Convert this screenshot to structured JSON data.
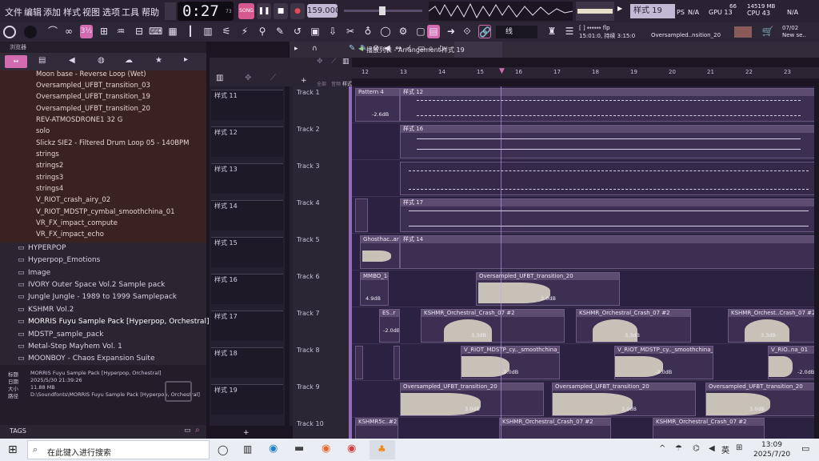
{
  "menu": [
    "文件",
    "编辑",
    "添加",
    "样式",
    "视图",
    "选项",
    "工具",
    "帮助"
  ],
  "transport": {
    "time": "0:27",
    "time_small": "73",
    "tempo": "159.000",
    "pattern": "样式 19",
    "cpu": "43",
    "ram": "14519 MB",
    "mem_small": "66",
    "gpu": "N/A",
    "gpu_label": "GPU 13",
    "cpu_label": "CPU 43"
  },
  "hint": {
    "line1": "[ ] ↔↔↔ flp",
    "line2": "15:01:0, 持续 3:15:0",
    "file": "Oversampled..nsition_20"
  },
  "news": {
    "date": "07/02",
    "text": "New se.."
  },
  "snap": "线",
  "browser": {
    "title": "浏览器",
    "files": [
      "Moon base - Reverse Loop (Wet)",
      "Oversampled_UFBT_transition_03",
      "Oversampled_UFBT_transition_19",
      "Oversampled_UFBT_transition_20",
      "REV-ATMOSDRONE1 32 G",
      "solo",
      "Slickz SIE2 - Filtered Drum Loop 05 - 140BPM",
      "strings",
      "strings2",
      "strings3",
      "strings4",
      "V_RIOT_crash_airy_02",
      "V_RIOT_MDSTP_cymbal_smoothchina_01",
      "VR_FX_impact_compute",
      "VR_FX_impact_echo"
    ],
    "folders": [
      "HYPERPOP",
      "Hyperpop_Emotions",
      "Image",
      "IVORY Outer Space Vol.2 Sample pack",
      "Jungle Jungle - 1989 to 1999 Samplepack",
      "KSHMR Vol.2",
      "MORRIS Fuyu Sample Pack [Hyperpop, Orchestral]",
      "MDSTP_sample_pack",
      "Metal-Step Mayhem Vol. 1",
      "MOONBOY - Chaos Expansion Suite"
    ],
    "info": {
      "labels": [
        "标题",
        "日期",
        "大小",
        "路径"
      ],
      "values": [
        "MORRIS Fuyu Sample Pack [Hyperpop, Orchestral]",
        "2025/5/30 21:39:26",
        "11.88 MB",
        "D:\\Soundfonts\\MORRIS Fuyu Sample Pack [Hyperpop, Orchestral]"
      ]
    },
    "tags": "TAGS"
  },
  "playlist": {
    "title": "播放列表 - Arrangement",
    "pattern": "样式 19",
    "ruler": [
      "12",
      "13",
      "14",
      "15",
      "16",
      "17",
      "18",
      "19",
      "20",
      "21",
      "22",
      "23"
    ],
    "tracks": [
      "Track 1",
      "Track 2",
      "Track 3",
      "Track 4",
      "Track 5",
      "Track 6",
      "Track 7",
      "Track 8",
      "Track 9",
      "Track 10"
    ],
    "pickers": [
      "样式 11",
      "样式 12",
      "样式 13",
      "样式 14",
      "样式 15",
      "样式 16",
      "样式 17",
      "样式 18",
      "样式 19"
    ],
    "clips": {
      "t1a": "Pattern 4",
      "t1b": "样式 12",
      "t1gain": "-2.6dB",
      "t2": "样式 16",
      "t4": "样式 17",
      "t5a": "Ghosthac..ar",
      "t5b": "样式 14",
      "t6a": "MMBO_14",
      "t6g": "4.9dB",
      "t6b": "Oversampled_UFBT_transition_20",
      "t6bg": "3.0dB",
      "t7a": "ES..r",
      "t7ag": "-2.0dB",
      "t7b": "KSHMR_Orchestral_Crash_07 #2",
      "t7g": "3.3dB",
      "t7c": "KSHMR_Orchestral_Crash_07 #2",
      "t7d": "KSHMR_Orchest..Crash_07 #2",
      "t8b": "V_RIOT_MDSTP_cy.._smoothchina_01",
      "t8g": "-2.0dB",
      "t8c": "V_RIOT_MDSTP_cy.._smoothchina_01",
      "t8d": "V_RIO..na_01",
      "t8dg": "-2.0dB",
      "t9b": "Oversampled_UFBT_transition_20",
      "t9g": "3.0dB",
      "t9c": "Oversampled_UFBT_transition_20",
      "t9d": "Oversampled_UFBT_transition_20",
      "t10a": "KSHMR5c..#2",
      "t10b": "KSHMR_Orchestral_Crash_07 #2",
      "t10c": "KSHMR_Orchestral_Crash_07 #2"
    }
  },
  "taskbar": {
    "search": "在此键入进行搜索",
    "time": "13:09",
    "date": "2025/7/20",
    "ime": "英"
  }
}
